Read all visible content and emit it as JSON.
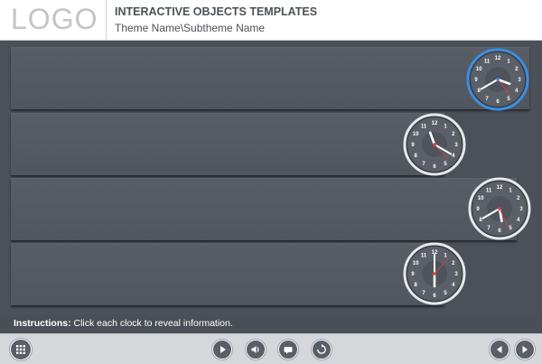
{
  "header": {
    "logo": "LOGO",
    "title": "INTERACTIVE OBJECTS TEMPLATES",
    "subtitle": "Theme Name\\Subtheme Name"
  },
  "clocks": [
    {
      "name": "clock-1",
      "time": "3:40",
      "active": true
    },
    {
      "name": "clock-2",
      "time": "11:20"
    },
    {
      "name": "clock-3",
      "time": "5:40"
    },
    {
      "name": "clock-4",
      "time": "6:00"
    }
  ],
  "clock_numbers": [
    "12",
    "1",
    "2",
    "3",
    "4",
    "5",
    "6",
    "7",
    "8",
    "9",
    "10",
    "11"
  ],
  "instructions": {
    "label": "Instructions:",
    "text": " Click each clock to reveal information."
  },
  "footer": {
    "icons": [
      "menu-grid-icon",
      "play-icon",
      "audio-icon",
      "caption-icon",
      "replay-icon",
      "back-icon",
      "next-icon"
    ]
  },
  "colors": {
    "accent": "#3d8fe0",
    "stage": "#4c5159",
    "second_hand": "#e04040"
  }
}
